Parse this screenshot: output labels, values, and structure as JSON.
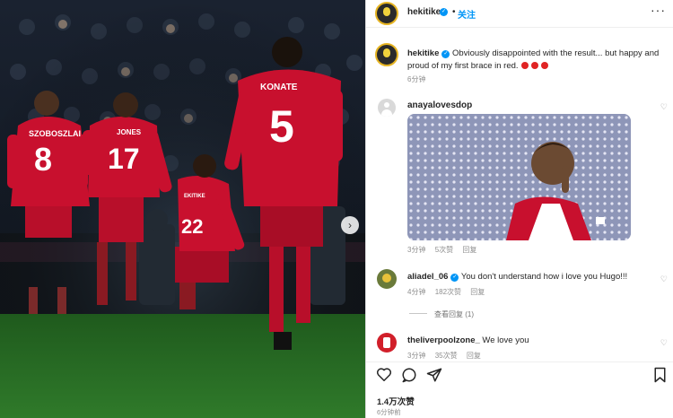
{
  "post": {
    "username": "hekitike",
    "follow_label": "关注",
    "separator": "•",
    "more_label": "···"
  },
  "caption": {
    "username": "hekitike",
    "text": "Obviously disappointed with the result... but happy and proud of my first brace in red.",
    "time": "6分钟"
  },
  "photo": {
    "players": [
      {
        "name": "SZOBOSZLAI",
        "number": "8"
      },
      {
        "name": "JONES",
        "number": "17"
      },
      {
        "name": "EKITIKE",
        "number": "22"
      },
      {
        "name": "KONATE",
        "number": "5"
      }
    ],
    "kit_color": "#c8102e"
  },
  "comments": [
    {
      "username": "anayalovesdop",
      "text": "",
      "time": "3分钟",
      "likes": "5次赞",
      "reply": "回复",
      "gif": true
    },
    {
      "username": "aliadel_06",
      "text": "You don't understand how i love you Hugo!!!",
      "time": "4分钟",
      "likes": "182次赞",
      "reply": "回复",
      "verified": true,
      "view_replies": "查看回复 (1)"
    },
    {
      "username": "theliverpoolzone_",
      "text": "We love you",
      "time": "3分钟",
      "likes": "35次赞",
      "reply": "回复"
    }
  ],
  "footer": {
    "likes": "1.4万次赞",
    "time": "6分钟前"
  },
  "colors": {
    "accent": "#0095f6",
    "text": "#262626",
    "muted": "#8e8e8e"
  }
}
